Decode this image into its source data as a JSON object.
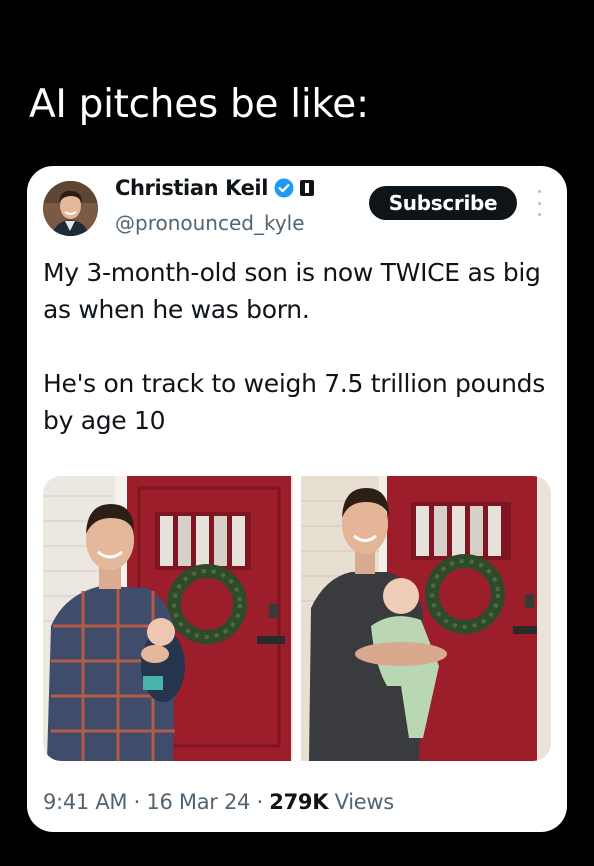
{
  "meme": {
    "caption": "AI pitches be like:"
  },
  "tweet": {
    "author_name": "Christian Keil",
    "handle": "@pronounced_kyle",
    "subscribe_label": "Subscribe",
    "text": "My 3-month-old son is now TWICE as big as when he was born.\n\nHe's on track to weigh 7.5 trillion pounds by age 10",
    "time": "9:41 AM",
    "separator": "·",
    "date": "16 Mar 24",
    "views_count": "279K",
    "views_label": "Views"
  },
  "colors": {
    "verified": "#1d9bf0",
    "door": "#9b1e2a",
    "text": "#0f1419",
    "secondary": "#536471"
  },
  "icons": [
    "verified-badge-icon",
    "affiliation-badge-icon",
    "more-options-icon"
  ]
}
